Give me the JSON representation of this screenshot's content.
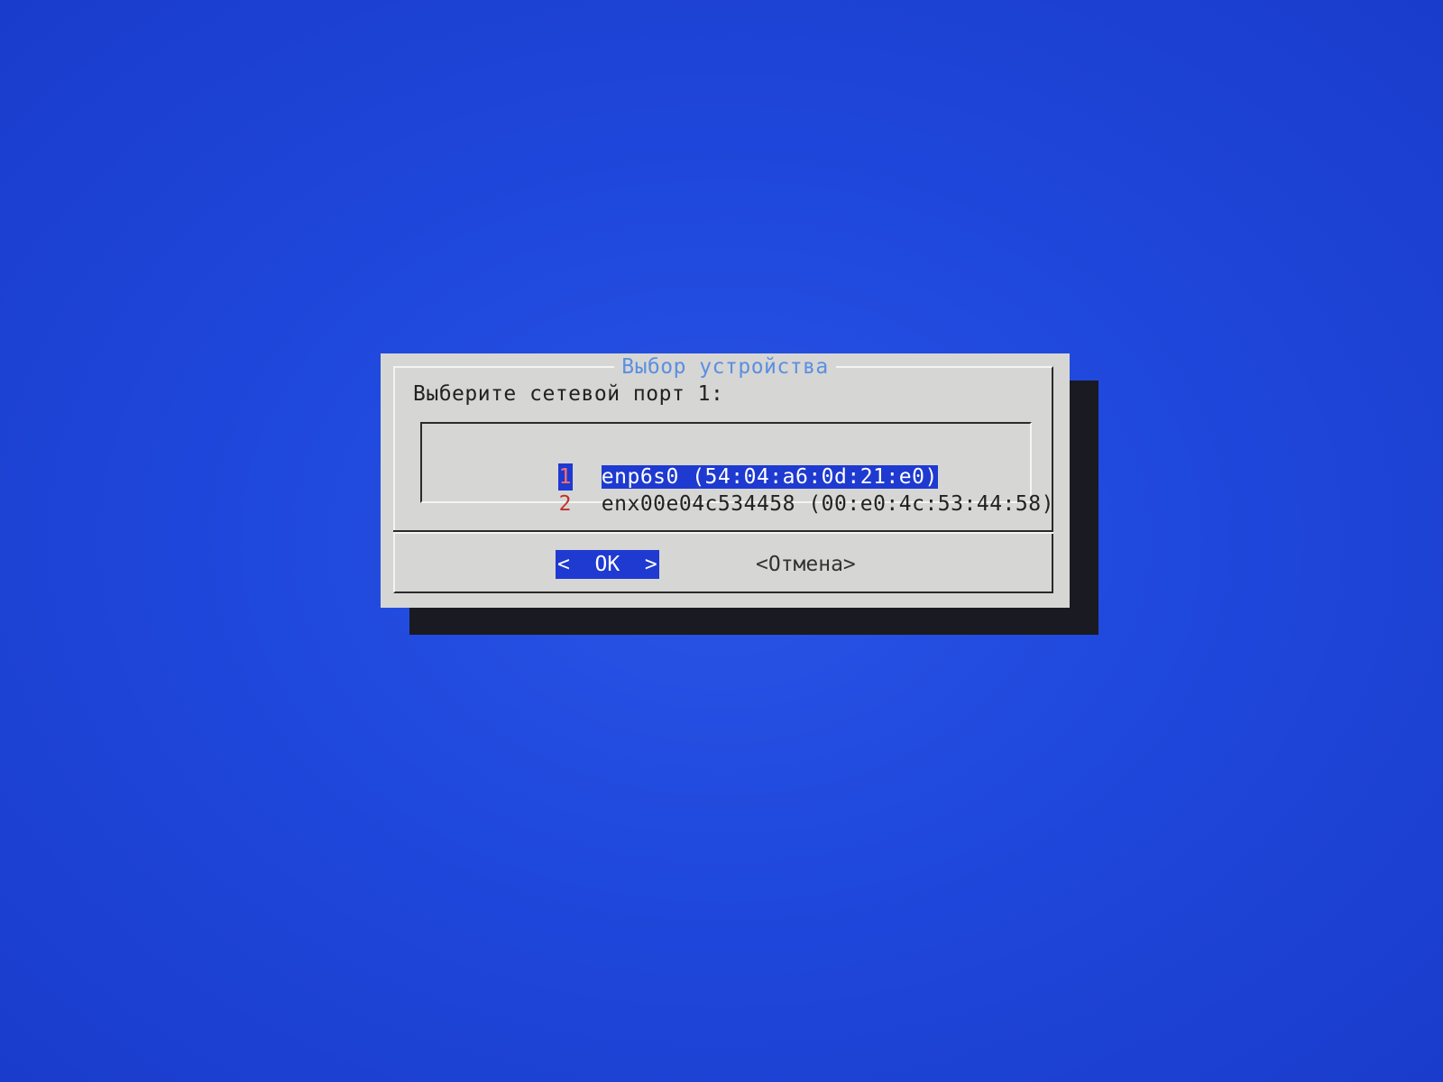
{
  "dialog": {
    "title": "Выбор устройства",
    "prompt": "Выберите сетевой порт 1:",
    "items": [
      {
        "number": "1",
        "label": "enp6s0 (54:04:a6:0d:21:e0)",
        "selected": true
      },
      {
        "number": "2",
        "label": "enx00e04c534458 (00:e0:4c:53:44:58)",
        "selected": false
      }
    ],
    "buttons": {
      "ok_label": "<  OK  >",
      "cancel_label": "<Отмена>"
    }
  },
  "colors": {
    "background": "#1f48dc",
    "dialog_bg": "#d6d6d4",
    "title": "#5b8fe0",
    "highlight": "#1e3ad0",
    "item_number": "#c0302a"
  }
}
